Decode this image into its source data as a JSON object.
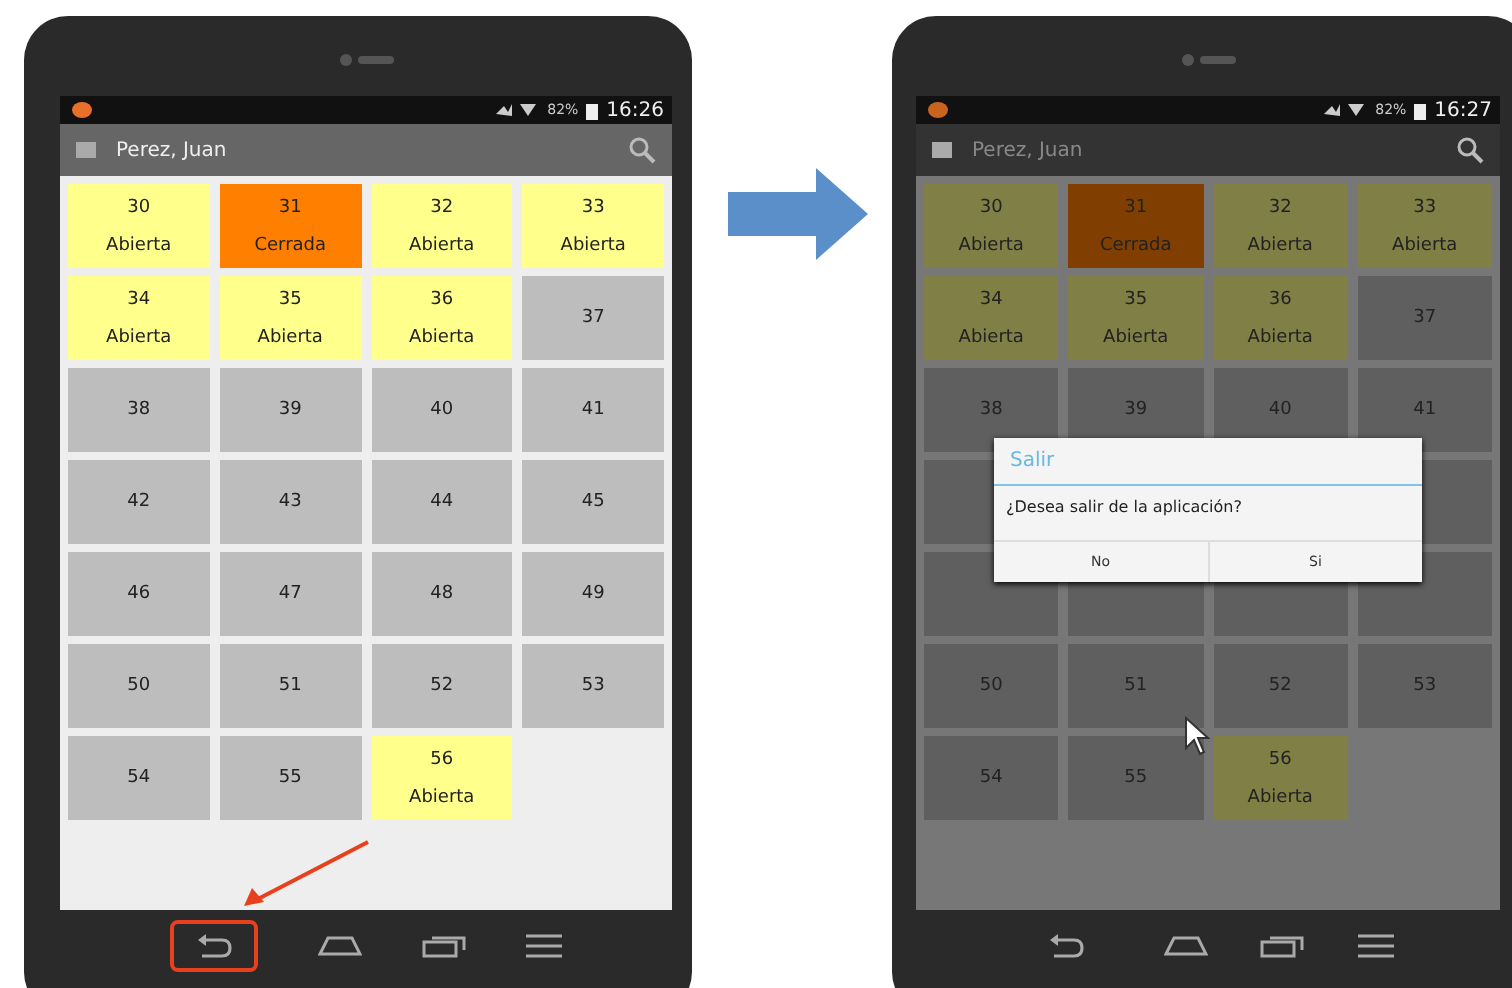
{
  "screens": [
    {
      "dimmed": false,
      "status_bar": {
        "battery": "82%",
        "time": "16:26"
      },
      "app_bar": {
        "title": "Perez, Juan"
      },
      "tiles": [
        {
          "number": "30",
          "label": "Abierta",
          "color": "#ffff8c"
        },
        {
          "number": "31",
          "label": "Cerrada",
          "color": "#ff7f00"
        },
        {
          "number": "32",
          "label": "Abierta",
          "color": "#ffff8c"
        },
        {
          "number": "33",
          "label": "Abierta",
          "color": "#ffff8c"
        },
        {
          "number": "34",
          "label": "Abierta",
          "color": "#ffff8c"
        },
        {
          "number": "35",
          "label": "Abierta",
          "color": "#ffff8c"
        },
        {
          "number": "36",
          "label": "Abierta",
          "color": "#ffff8c"
        },
        {
          "number": "37",
          "color": "#bdbdbd"
        },
        {
          "number": "38",
          "color": "#bdbdbd"
        },
        {
          "number": "39",
          "color": "#bdbdbd"
        },
        {
          "number": "40",
          "color": "#bdbdbd"
        },
        {
          "number": "41",
          "color": "#bdbdbd"
        },
        {
          "number": "42",
          "color": "#bdbdbd"
        },
        {
          "number": "43",
          "color": "#bdbdbd"
        },
        {
          "number": "44",
          "color": "#bdbdbd"
        },
        {
          "number": "45",
          "color": "#bdbdbd"
        },
        {
          "number": "46",
          "color": "#bdbdbd"
        },
        {
          "number": "47",
          "color": "#bdbdbd"
        },
        {
          "number": "48",
          "color": "#bdbdbd"
        },
        {
          "number": "49",
          "color": "#bdbdbd"
        },
        {
          "number": "50",
          "color": "#bdbdbd"
        },
        {
          "number": "51",
          "color": "#bdbdbd"
        },
        {
          "number": "52",
          "color": "#bdbdbd"
        },
        {
          "number": "53",
          "color": "#bdbdbd"
        },
        {
          "number": "54",
          "color": "#bdbdbd"
        },
        {
          "number": "55",
          "color": "#bdbdbd"
        },
        {
          "number": "56",
          "label": "Abierta",
          "color": "#ffff8c"
        }
      ],
      "back_highlighted": true,
      "pointer_visible": false
    },
    {
      "dimmed": true,
      "status_bar": {
        "battery": "82%",
        "time": "16:27"
      },
      "app_bar": {
        "title": "Perez, Juan"
      },
      "tiles": [
        {
          "number": "30",
          "label": "Abierta",
          "color": "#7f7f46"
        },
        {
          "number": "31",
          "label": "Cerrada",
          "color": "#803f00"
        },
        {
          "number": "32",
          "label": "Abierta",
          "color": "#7f7f46"
        },
        {
          "number": "33",
          "label": "Abierta",
          "color": "#7f7f46"
        },
        {
          "number": "34",
          "label": "Abierta",
          "color": "#7f7f46"
        },
        {
          "number": "35",
          "label": "Abierta",
          "color": "#7f7f46"
        },
        {
          "number": "36",
          "label": "Abierta",
          "color": "#7f7f46"
        },
        {
          "number": "37",
          "color": "#5f5f5f"
        },
        {
          "number": "38",
          "color": "#5f5f5f"
        },
        {
          "number": "39",
          "color": "#5f5f5f"
        },
        {
          "number": "40",
          "color": "#5f5f5f"
        },
        {
          "number": "41",
          "color": "#5f5f5f"
        },
        {
          "color": "#5f5f5f"
        },
        {
          "color": "#5f5f5f"
        },
        {
          "color": "#5f5f5f"
        },
        {
          "color": "#5f5f5f"
        },
        {
          "color": "#5f5f5f"
        },
        {
          "color": "#5f5f5f"
        },
        {
          "number": "50",
          "color": "#5f5f5f"
        },
        {
          "number": "51",
          "color": "#5f5f5f"
        },
        {
          "number": "52",
          "color": "#5f5f5f"
        },
        {
          "number": "53",
          "color": "#5f5f5f"
        },
        {
          "number": "54",
          "color": "#5f5f5f"
        },
        {
          "number": "55",
          "color": "#5f5f5f"
        },
        {
          "number": "56",
          "label": "Abierta",
          "color": "#7f7f46"
        }
      ],
      "dialog": {
        "title": "Salir",
        "message": "¿Desea salir de la aplicación?",
        "buttons": [
          "No",
          "Si"
        ]
      },
      "back_highlighted": false,
      "pointer_visible": true
    }
  ]
}
